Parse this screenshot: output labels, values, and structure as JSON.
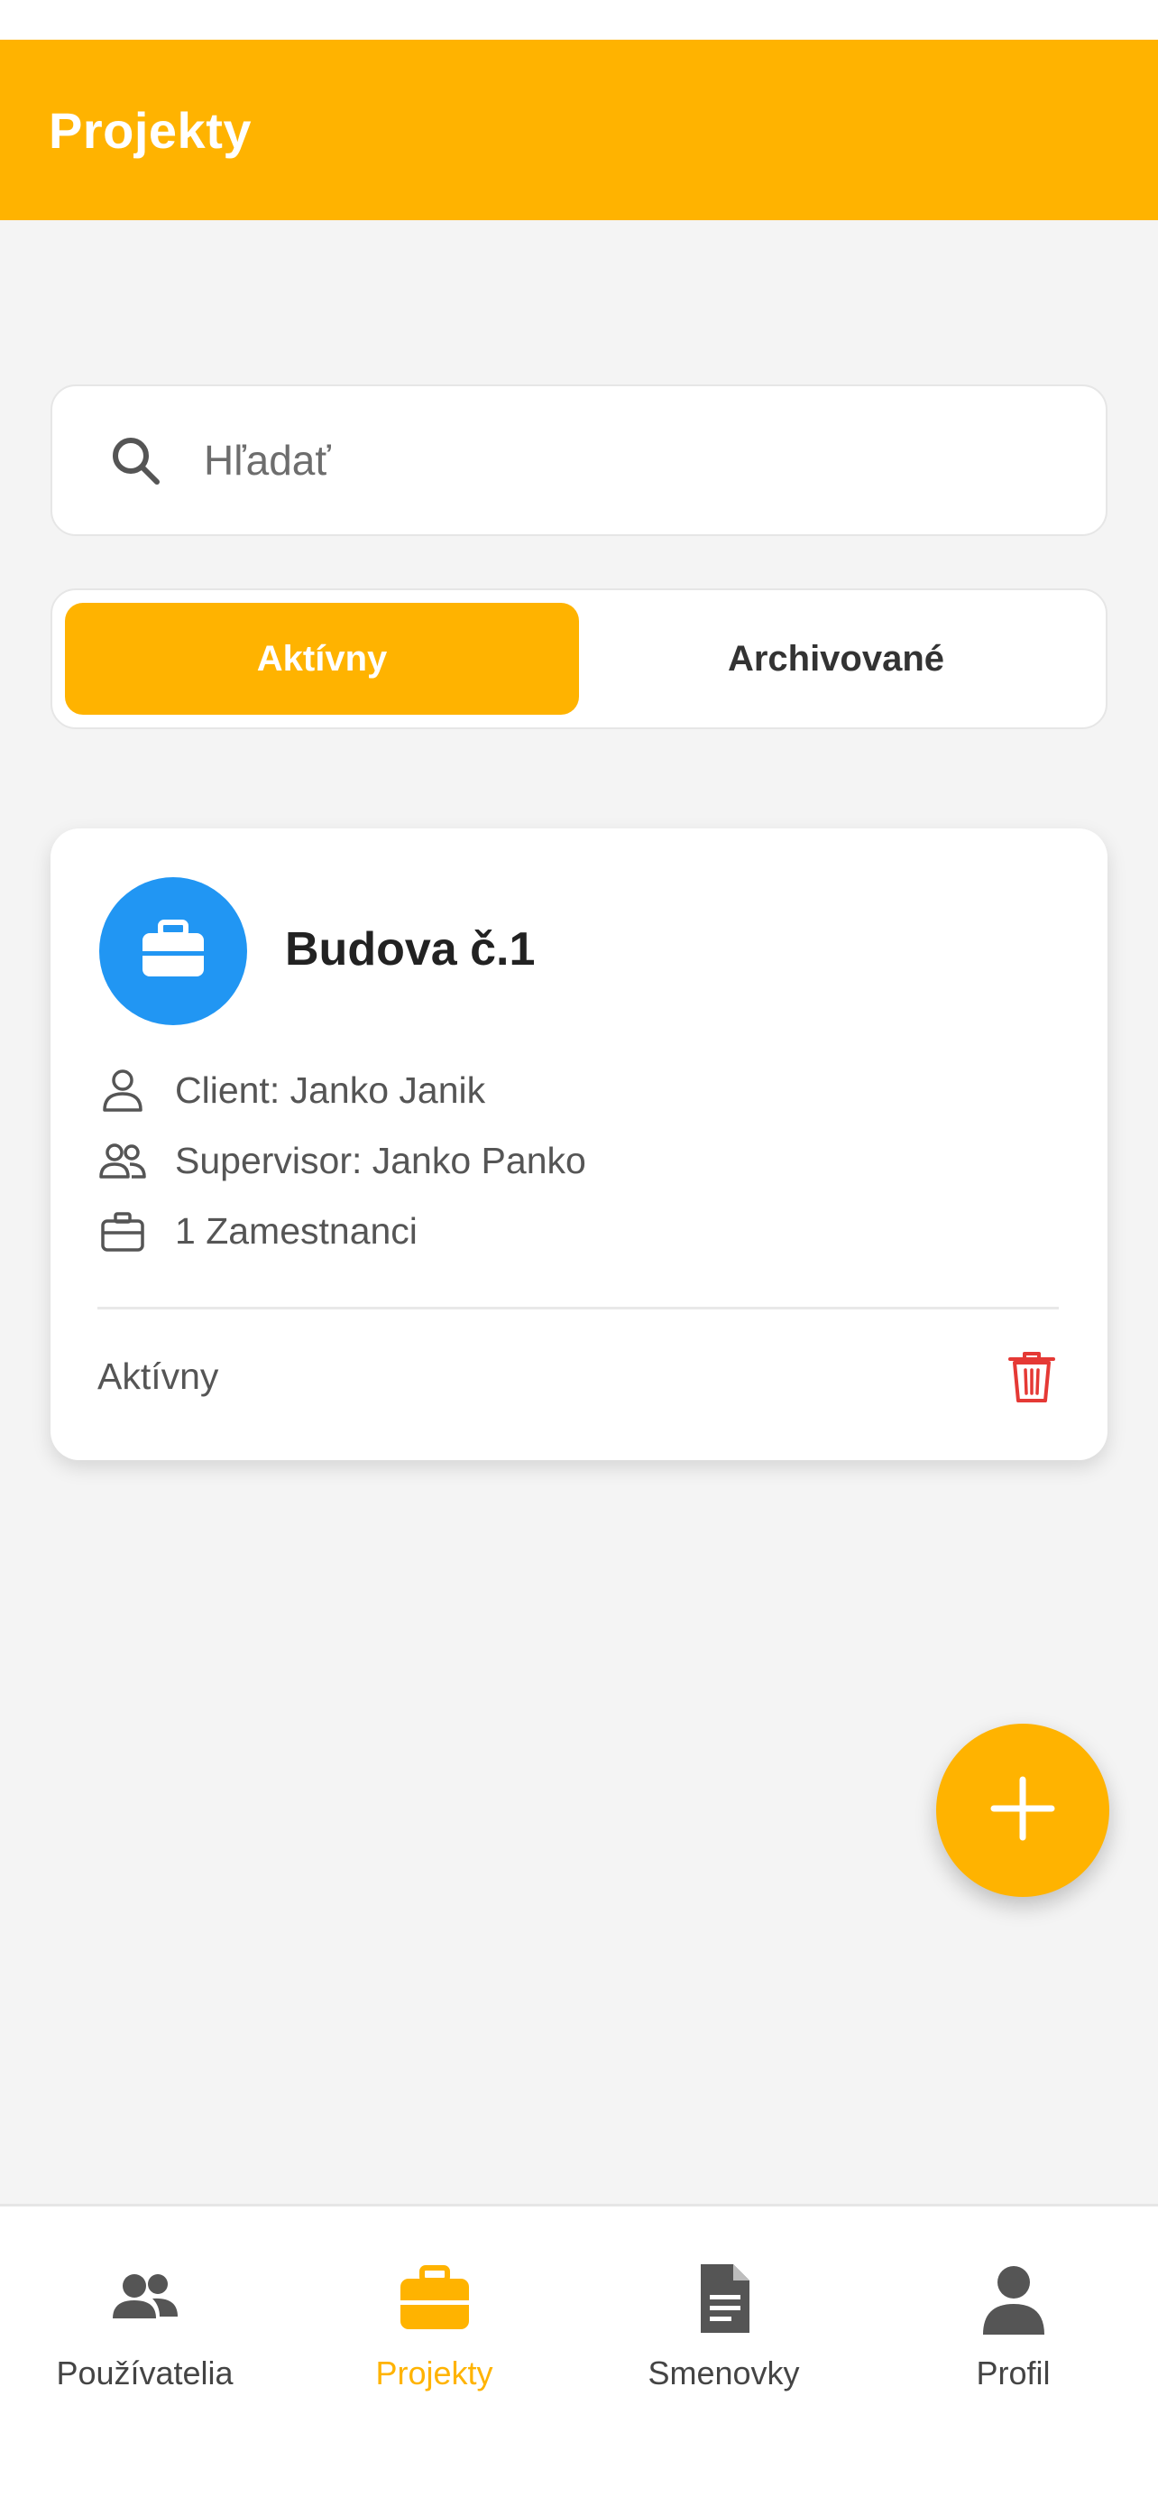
{
  "app_bar": {
    "title": "Projekty"
  },
  "search": {
    "placeholder": "Hľadať",
    "value": ""
  },
  "filter_tabs": [
    {
      "label": "Aktívny",
      "selected": true
    },
    {
      "label": "Archivované",
      "selected": false
    }
  ],
  "projects": [
    {
      "name": "Budova č.1",
      "client": "Client: Janko Janik",
      "supervisor": "Supervisor: Janko Panko",
      "employees": "1 Zamestnanci",
      "status": "Aktívny"
    }
  ],
  "bottom_nav": [
    {
      "label": "Používatelia",
      "icon": "users-icon",
      "active": false
    },
    {
      "label": "Projekty",
      "icon": "briefcase-icon",
      "active": true
    },
    {
      "label": "Smenovky",
      "icon": "document-icon",
      "active": false
    },
    {
      "label": "Profil",
      "icon": "person-icon",
      "active": false
    }
  ],
  "colors": {
    "accent": "#FFB300",
    "avatar": "#2196F3",
    "danger": "#E53935",
    "background": "#F4F4F4"
  }
}
